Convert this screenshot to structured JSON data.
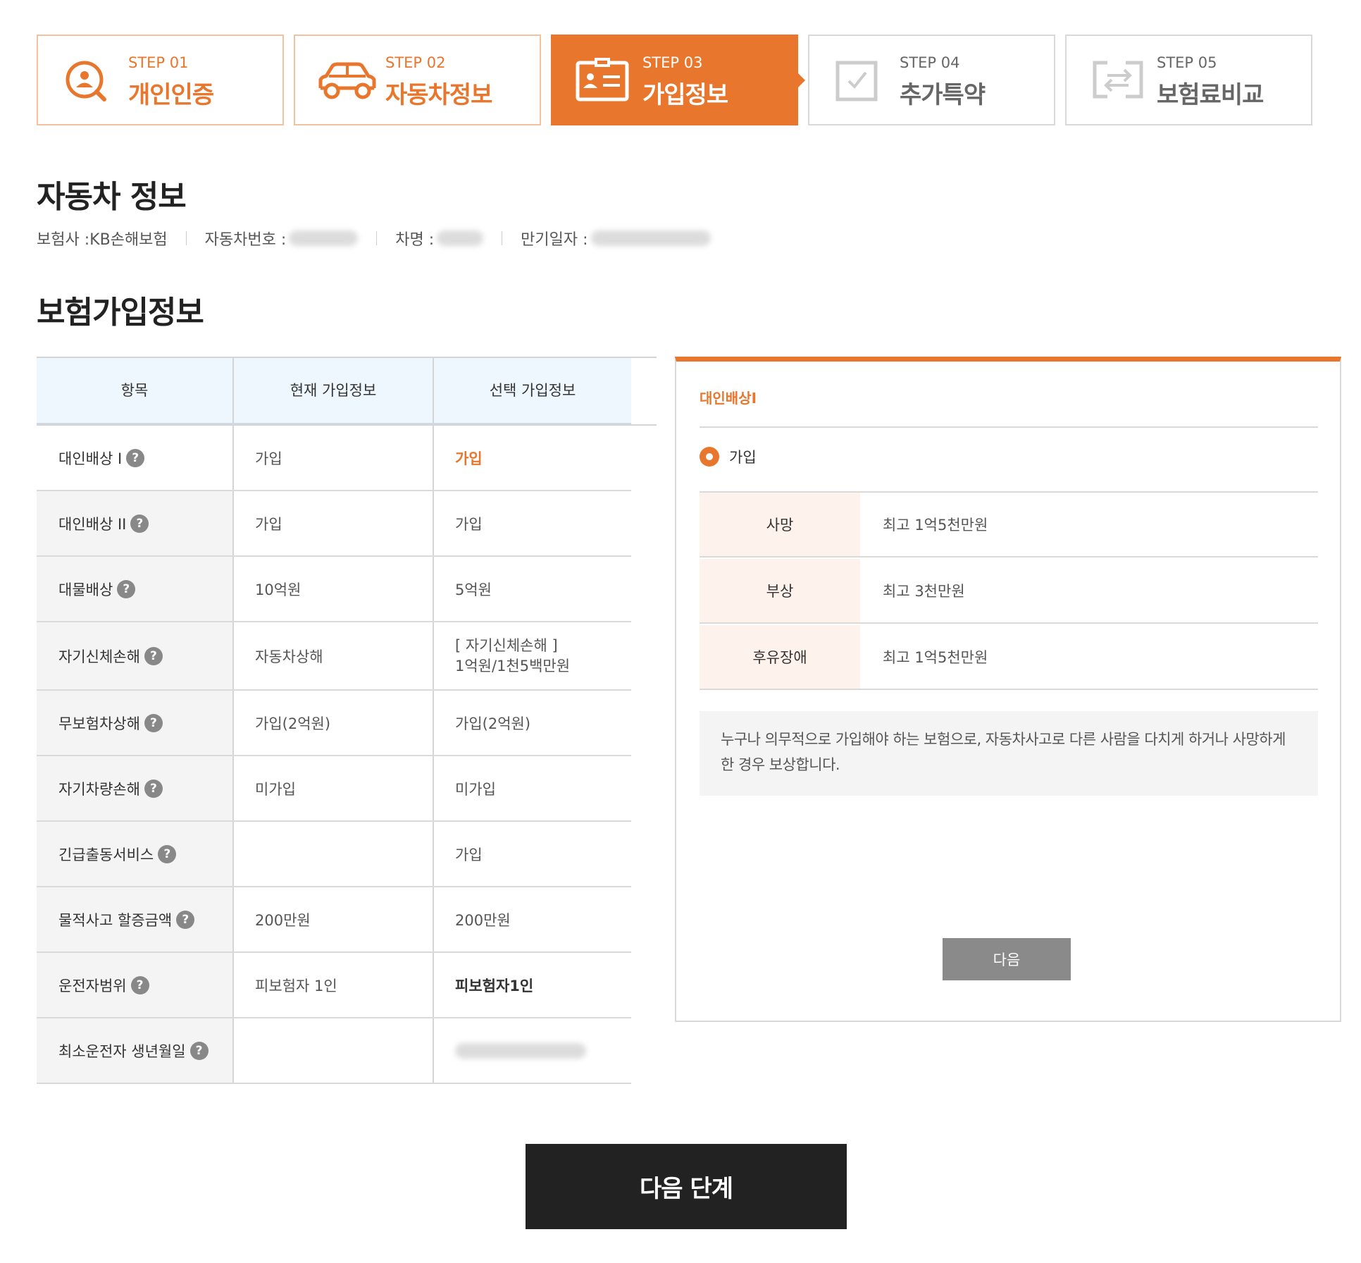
{
  "steps": [
    {
      "num": "STEP 01",
      "label": "개인인증",
      "state": "done",
      "icon": "user-search-icon"
    },
    {
      "num": "STEP 02",
      "label": "자동차정보",
      "state": "done",
      "icon": "car-icon"
    },
    {
      "num": "STEP 03",
      "label": "가입정보",
      "state": "active",
      "icon": "id-card-icon"
    },
    {
      "num": "STEP 04",
      "label": "추가특약",
      "state": "todo",
      "icon": "checkbox-icon"
    },
    {
      "num": "STEP 05",
      "label": "보험료비교",
      "state": "todo",
      "icon": "compare-icon"
    }
  ],
  "car_section": {
    "title": "자동차 정보",
    "insurer_label": "보험사 :",
    "insurer_value": "KB손해보험",
    "car_number_label": "자동차번호 :",
    "car_name_label": "차명 :",
    "expiry_label": "만기일자 :"
  },
  "insurance_section": {
    "title": "보험가입정보",
    "headers": [
      "항목",
      "현재 가입정보",
      "선택 가입정보"
    ],
    "rows": [
      {
        "item": "대인배상 I",
        "current": "가입",
        "selected": "가입",
        "style": "accent"
      },
      {
        "item": "대인배상 II",
        "current": "가입",
        "selected": "가입"
      },
      {
        "item": "대물배상",
        "current": "10억원",
        "selected": "5억원"
      },
      {
        "item": "자기신체손해",
        "current": "자동차상해",
        "selected": "[ 자기신체손해 ]",
        "selected2": "1억원/1천5백만원"
      },
      {
        "item": "무보험차상해",
        "current": "가입(2억원)",
        "selected": "가입(2억원)"
      },
      {
        "item": "자기차량손해",
        "current": "미가입",
        "selected": "미가입"
      },
      {
        "item": "긴급출동서비스",
        "current": "",
        "selected": "가입"
      },
      {
        "item": "물적사고 할증금액",
        "current": "200만원",
        "selected": "200만원"
      },
      {
        "item": "운전자범위",
        "current": "피보험자 1인",
        "selected": "피보험자1인",
        "style": "bold"
      },
      {
        "item": "최소운전자 생년월일",
        "current": "",
        "selected": ""
      }
    ]
  },
  "detail_panel": {
    "title": "대인배상I",
    "radio_label": "가입",
    "coverage": [
      {
        "key": "사망",
        "value": "최고 1억5천만원"
      },
      {
        "key": "부상",
        "value": "최고 3천만원"
      },
      {
        "key": "후유장애",
        "value": "최고 1억5천만원"
      }
    ],
    "description": "누구나 의무적으로 가입해야 하는 보험으로, 자동차사고로 다른 사람을 다치게 하거나 사망하게 한 경우 보상합니다.",
    "next_label": "다음"
  },
  "next_step_label": "다음 단계",
  "colors": {
    "accent": "#e8762c",
    "dark": "#222222",
    "header_bg": "#eef7fd"
  }
}
